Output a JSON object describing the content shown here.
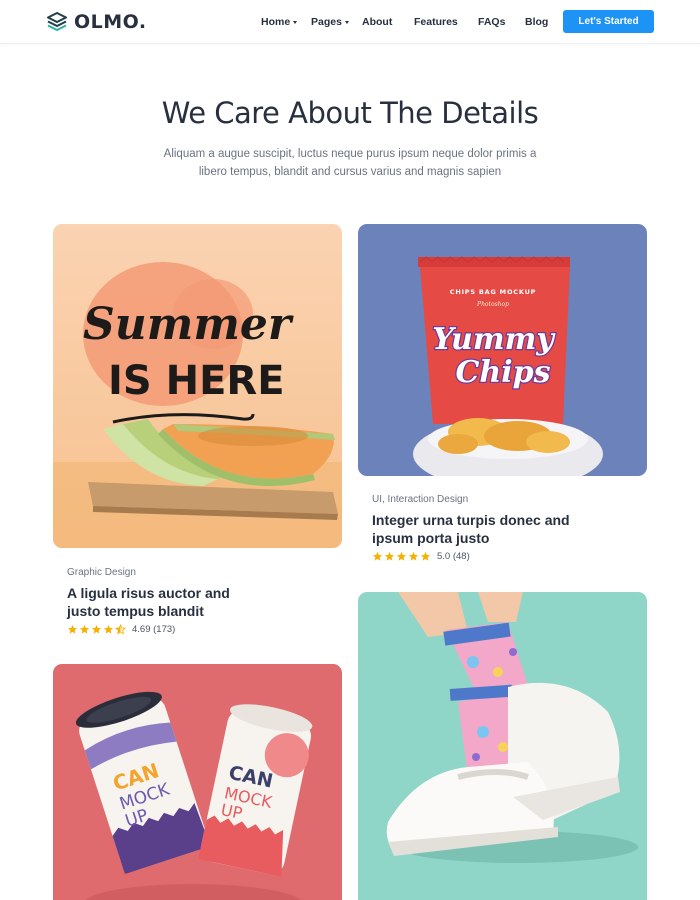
{
  "brand": {
    "name": "OLMO."
  },
  "nav": {
    "items": [
      {
        "label": "Home",
        "dropdown": true
      },
      {
        "label": "Pages",
        "dropdown": true
      },
      {
        "label": "About",
        "dropdown": false
      },
      {
        "label": "Features",
        "dropdown": false
      },
      {
        "label": "FAQs",
        "dropdown": false
      },
      {
        "label": "Blog",
        "dropdown": false
      }
    ],
    "cta_label": "Let's Started"
  },
  "section": {
    "title": "We Care About The Details",
    "subtitle": "Aliquam a augue suscipit, luctus neque purus ipsum neque dolor primis a libero tempus, blandit and cursus varius and magnis sapien"
  },
  "projects": [
    {
      "category": "Graphic Design",
      "title": "A ligula risus auctor and justo tempus blandit",
      "rating": 4.5,
      "rating_text": "4.69 (173)",
      "image_text": [
        "Summer",
        "IS HERE"
      ]
    },
    {
      "category": "UI, Interaction Design",
      "title": "Integer urna turpis donec and ipsum porta justo",
      "rating": 5,
      "rating_text": "5.0 (48)",
      "image_text": [
        "CHIPS BAG MOCKUP",
        "Photoshop",
        "Yummy",
        "Chips"
      ]
    },
    {
      "image_text": [
        "CAN",
        "MOCK",
        "UP"
      ]
    },
    {
      "image_text": []
    }
  ],
  "colors": {
    "accent": "#1e93f6",
    "star": "#f6b100",
    "text": "#283040",
    "muted": "#6b7280"
  }
}
